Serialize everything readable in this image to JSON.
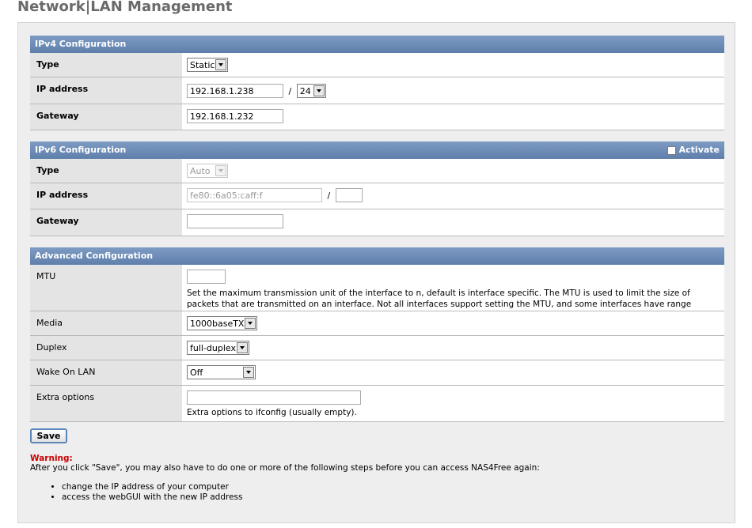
{
  "page_title": "Network|LAN Management",
  "ipv4": {
    "header": "IPv4 Configuration",
    "type_label": "Type",
    "type_value": "Static",
    "ip_label": "IP address",
    "ip_value": "192.168.1.238",
    "slash": "/",
    "mask_value": "24",
    "gateway_label": "Gateway",
    "gateway_value": "192.168.1.232"
  },
  "ipv6": {
    "header": "IPv6 Configuration",
    "activate_label": "Activate",
    "type_label": "Type",
    "type_value": "Auto",
    "ip_label": "IP address",
    "ip_value": "fe80::6a05:caff:f",
    "slash": "/",
    "prefix_value": "",
    "gateway_label": "Gateway",
    "gateway_value": ""
  },
  "advanced": {
    "header": "Advanced Configuration",
    "mtu_label": "MTU",
    "mtu_value": "",
    "mtu_help": "Set the maximum transmission unit of the interface to n, default is interface specific. The MTU is used to limit the size of packets that are transmitted on an interface. Not all interfaces support setting the MTU, and some interfaces have range restrictions.",
    "media_label": "Media",
    "media_value": "1000baseTX",
    "duplex_label": "Duplex",
    "duplex_value": "full-duplex",
    "wol_label": "Wake On LAN",
    "wol_value": "Off",
    "extra_label": "Extra options",
    "extra_value": "",
    "extra_help": "Extra options to ifconfig (usually empty)."
  },
  "save_label": "Save",
  "warning": {
    "title": "Warning:",
    "text": "After you click \"Save\", you may also have to do one or more of the following steps before you can access NAS4Free again:",
    "steps": [
      "change the IP address of your computer",
      "access the webGUI with the new IP address"
    ]
  },
  "colors": {
    "section_header": "#6a89b4",
    "warning": "#cc0000",
    "title": "#6a6a6a"
  }
}
